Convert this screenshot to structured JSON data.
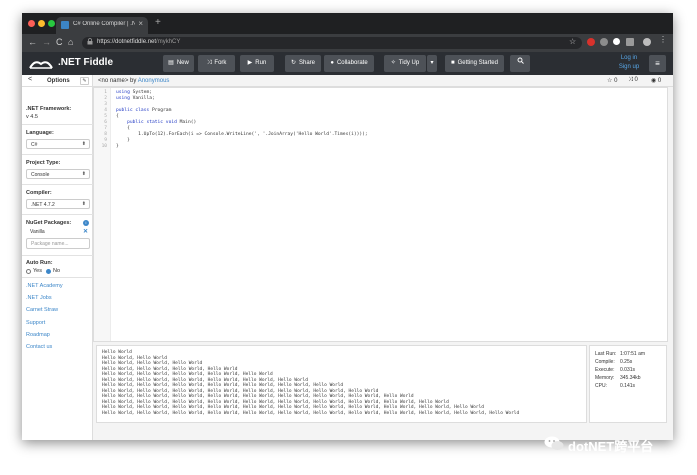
{
  "browser": {
    "tab_title": "C# Online Compiler | .NET Fid",
    "tab_close": "×",
    "new_tab": "+",
    "url_host": "https://dotnetfiddle.net",
    "url_path": "/mykhCY",
    "back": "←",
    "forward": "→",
    "reload": "C",
    "home": "⌂",
    "lock": "🔒",
    "bookmark": "☆"
  },
  "navbar": {
    "brand": ".NET Fiddle",
    "buttons": [
      {
        "label": "New",
        "icon": "new-file-icon"
      },
      {
        "label": "Fork",
        "icon": "fork-icon"
      },
      {
        "label": "Run",
        "icon": "play-icon"
      },
      {
        "label": "Share",
        "icon": "share-icon"
      },
      {
        "label": "Collaborate",
        "icon": "user-icon"
      },
      {
        "label": "Tidy Up",
        "icon": "tidy-icon"
      },
      {
        "label": "Getting Started",
        "icon": "book-icon"
      }
    ],
    "login": "Log in",
    "signup": "Sign up"
  },
  "sidebar": {
    "title": "Options",
    "back": "<",
    "framework_label": ".NET Framework:",
    "framework_value": "v 4.5",
    "language_label": "Language:",
    "language_value": "C#",
    "project_label": "Project Type:",
    "project_value": "Console",
    "compiler_label": "Compiler:",
    "compiler_value": ".NET 4.7.2",
    "nuget_label": "NuGet Packages:",
    "package": "Vanilla",
    "package_placeholder": "Package name...",
    "autorun_label": "Auto Run:",
    "autorun_yes": "Yes",
    "autorun_no": "No",
    "links": [
      ".NET Academy",
      ".NET Jobs",
      "Carnet Straw",
      "Support",
      "Roadmap",
      "Contact us"
    ]
  },
  "editor": {
    "name": "<no name>",
    "by": "by",
    "author": "Anonymous",
    "stars": "0",
    "forks": "0",
    "views": "0",
    "line_numbers": [
      "1",
      "2",
      "3",
      "4",
      "5",
      "6",
      "7",
      "8",
      "9",
      "10"
    ],
    "lines": [
      {
        "kw": "using ",
        "rest": "System;",
        "indent": ""
      },
      {
        "kw": "using ",
        "rest": "Vanilla;",
        "indent": ""
      },
      {
        "kw": "",
        "rest": "",
        "indent": ""
      },
      {
        "kw": "public class ",
        "rest": "Program",
        "indent": ""
      },
      {
        "kw": "",
        "rest": "{",
        "indent": ""
      },
      {
        "kw": "public static void ",
        "rest": "Main()",
        "indent": "    "
      },
      {
        "kw": "",
        "rest": "{",
        "indent": "    "
      },
      {
        "kw": "",
        "rest": "1.UpTo(12).ForEach(i => Console.WriteLine(', '.JoinArray('Hello World'.Times(i))));",
        "indent": "        "
      },
      {
        "kw": "",
        "rest": "}",
        "indent": "    "
      },
      {
        "kw": "",
        "rest": "}",
        "indent": ""
      }
    ]
  },
  "output": {
    "lines": [
      "Hello World",
      "Hello World, Hello World",
      "Hello World, Hello World, Hello World",
      "Hello World, Hello World, Hello World, Hello World",
      "Hello World, Hello World, Hello World, Hello World, Hello World",
      "Hello World, Hello World, Hello World, Hello World, Hello World, Hello World",
      "Hello World, Hello World, Hello World, Hello World, Hello World, Hello World, Hello World",
      "Hello World, Hello World, Hello World, Hello World, Hello World, Hello World, Hello World, Hello World",
      "Hello World, Hello World, Hello World, Hello World, Hello World, Hello World, Hello World, Hello World, Hello World",
      "Hello World, Hello World, Hello World, Hello World, Hello World, Hello World, Hello World, Hello World, Hello World, Hello World",
      "Hello World, Hello World, Hello World, Hello World, Hello World, Hello World, Hello World, Hello World, Hello World, Hello World, Hello World",
      "Hello World, Hello World, Hello World, Hello World, Hello World, Hello World, Hello World, Hello World, Hello World, Hello World, Hello World, Hello World"
    ]
  },
  "stats": {
    "last_run_label": "Last Run:",
    "last_run": "1:07:51 am",
    "compile_label": "Compile:",
    "compile": "0.25s",
    "execute_label": "Execute:",
    "execute": "0.031s",
    "memory_label": "Memory:",
    "memory": "345.34kb",
    "cpu_label": "CPU:",
    "cpu": "0.141s"
  },
  "watermark": {
    "text": "dotNET跨平台"
  },
  "colors": {
    "navbar": "#2b2e33",
    "link": "#3d87c9",
    "keyword": "#1f38c4",
    "string": "#c03030"
  }
}
